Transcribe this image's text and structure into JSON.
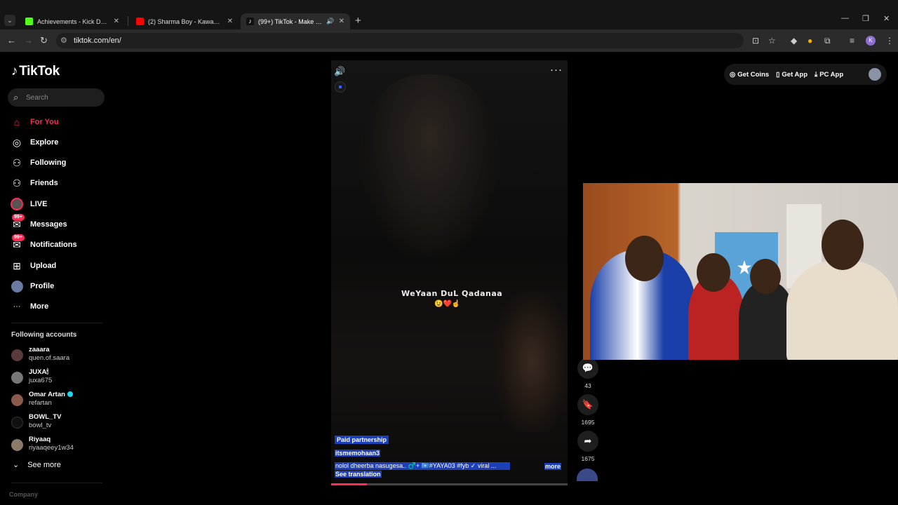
{
  "browser": {
    "tabs": [
      {
        "title": "Achievements - Kick Dashboard",
        "favicon_color": "#53fc18",
        "active": false
      },
      {
        "title": "(2) Sharma Boy - Kawadanaade",
        "favicon_color": "#ff0000",
        "active": false
      },
      {
        "title": "(99+) TikTok - Make Your Day",
        "favicon_color": "#ffffff",
        "active": true
      }
    ],
    "url": "tiktok.com/en/",
    "profile_initial": "K"
  },
  "sidebar": {
    "logo": "TikTok",
    "search_placeholder": "Search",
    "nav": [
      {
        "label": "For You",
        "icon": "home-icon",
        "glyph": "⌂",
        "active": true
      },
      {
        "label": "Explore",
        "icon": "compass-icon",
        "glyph": "◎"
      },
      {
        "label": "Following",
        "icon": "following-icon",
        "glyph": "⚇"
      },
      {
        "label": "Friends",
        "icon": "friends-icon",
        "glyph": "⚇"
      },
      {
        "label": "LIVE",
        "icon": "live-icon",
        "glyph": ""
      },
      {
        "label": "Messages",
        "icon": "messages-icon",
        "glyph": "✉",
        "badge": "99+"
      },
      {
        "label": "Notifications",
        "icon": "notifications-icon",
        "glyph": "✉",
        "badge": "99+"
      },
      {
        "label": "Upload",
        "icon": "upload-icon",
        "glyph": "⊞"
      },
      {
        "label": "Profile",
        "icon": "profile-avatar",
        "glyph": ""
      },
      {
        "label": "More",
        "icon": "more-icon",
        "glyph": "···"
      }
    ],
    "following_title": "Following accounts",
    "accounts": [
      {
        "name": "zaaara",
        "handle": "quen.of.saara"
      },
      {
        "name": "JUXA🕯",
        "handle": "juxa675"
      },
      {
        "name": "Omar Artan",
        "handle": "refartan",
        "verified": true
      },
      {
        "name": "BOWL_TV",
        "handle": "bowl_tv"
      },
      {
        "name": "Riyaaq",
        "handle": "riyaaqeey1w34"
      }
    ],
    "see_more": "See more",
    "company": "Company"
  },
  "video": {
    "overlay_text": "WeYaan DuL Qadanaa",
    "overlay_emoji": "😉❤️☝️",
    "paid_label": "Paid partnership",
    "author": "itsmemohaan3",
    "caption": "nolol dheerba nasugesa.. ♂️+ 🇸🇴#YAYA03  #fyb ✓ viral  ...",
    "more": "more",
    "see_translation": "See translation",
    "progress": 0.15
  },
  "actions": {
    "comments": "43",
    "saves": "1695",
    "shares": "1675"
  },
  "topbar": {
    "get_coins": "Get Coins",
    "get_app": "Get App",
    "pc_app": "PC App"
  },
  "colors": {
    "accent": "#fe2c55",
    "selection": "#1d3fb8"
  }
}
